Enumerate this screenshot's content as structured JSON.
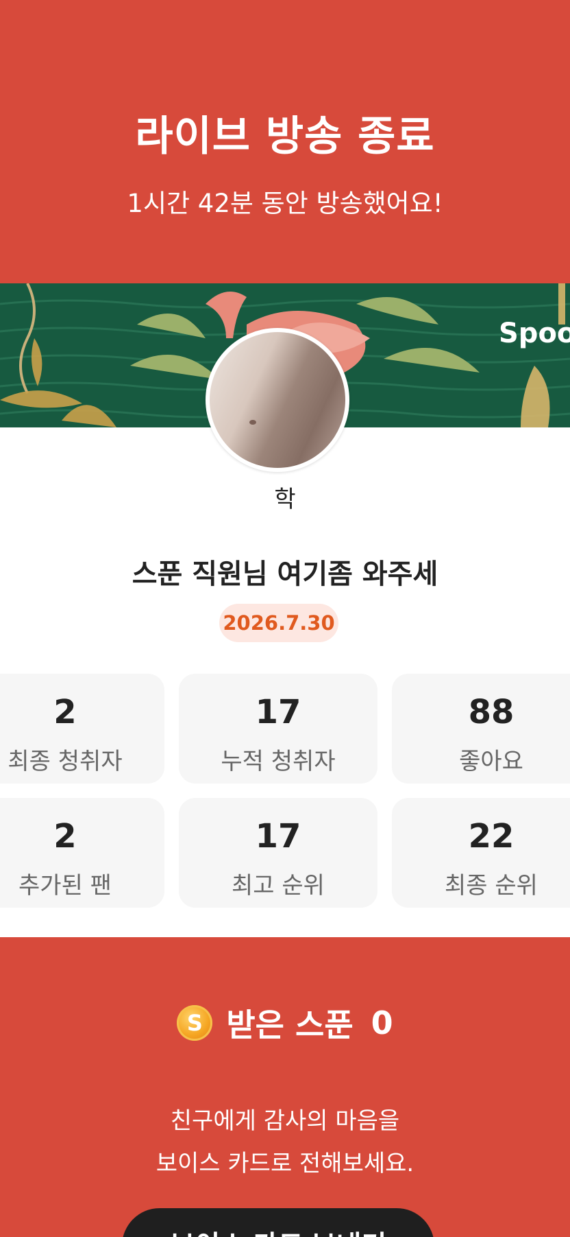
{
  "header": {
    "title": "라이브 방송 종료",
    "subtitle": "1시간 42분 동안 방송했어요!"
  },
  "banner": {
    "brand_text": "Spoon"
  },
  "profile": {
    "nickname": "학",
    "live_title": "스푼 직원님 여기좀 와주세",
    "date": "2026.7.30"
  },
  "stats": [
    {
      "value": "2",
      "label": "최종 청취자"
    },
    {
      "value": "17",
      "label": "누적 청취자"
    },
    {
      "value": "88",
      "label": "좋아요"
    },
    {
      "value": "2",
      "label": "추가된 팬"
    },
    {
      "value": "17",
      "label": "최고 순위"
    },
    {
      "value": "22",
      "label": "최종 순위"
    }
  ],
  "spoons": {
    "icon_letter": "S",
    "label": "받은 스푼",
    "count": "0"
  },
  "message": {
    "line1": "친구에게 감사의 마음을",
    "line2": "보이스 카드로 전해보세요."
  },
  "cta": {
    "label": "보이스 카드 보내기"
  },
  "colors": {
    "primary_red": "#d74a3b",
    "date_text": "#e05a1f",
    "date_bg": "#fde7e1",
    "card_bg": "#f6f6f6",
    "button_bg": "#1f1f1f"
  }
}
